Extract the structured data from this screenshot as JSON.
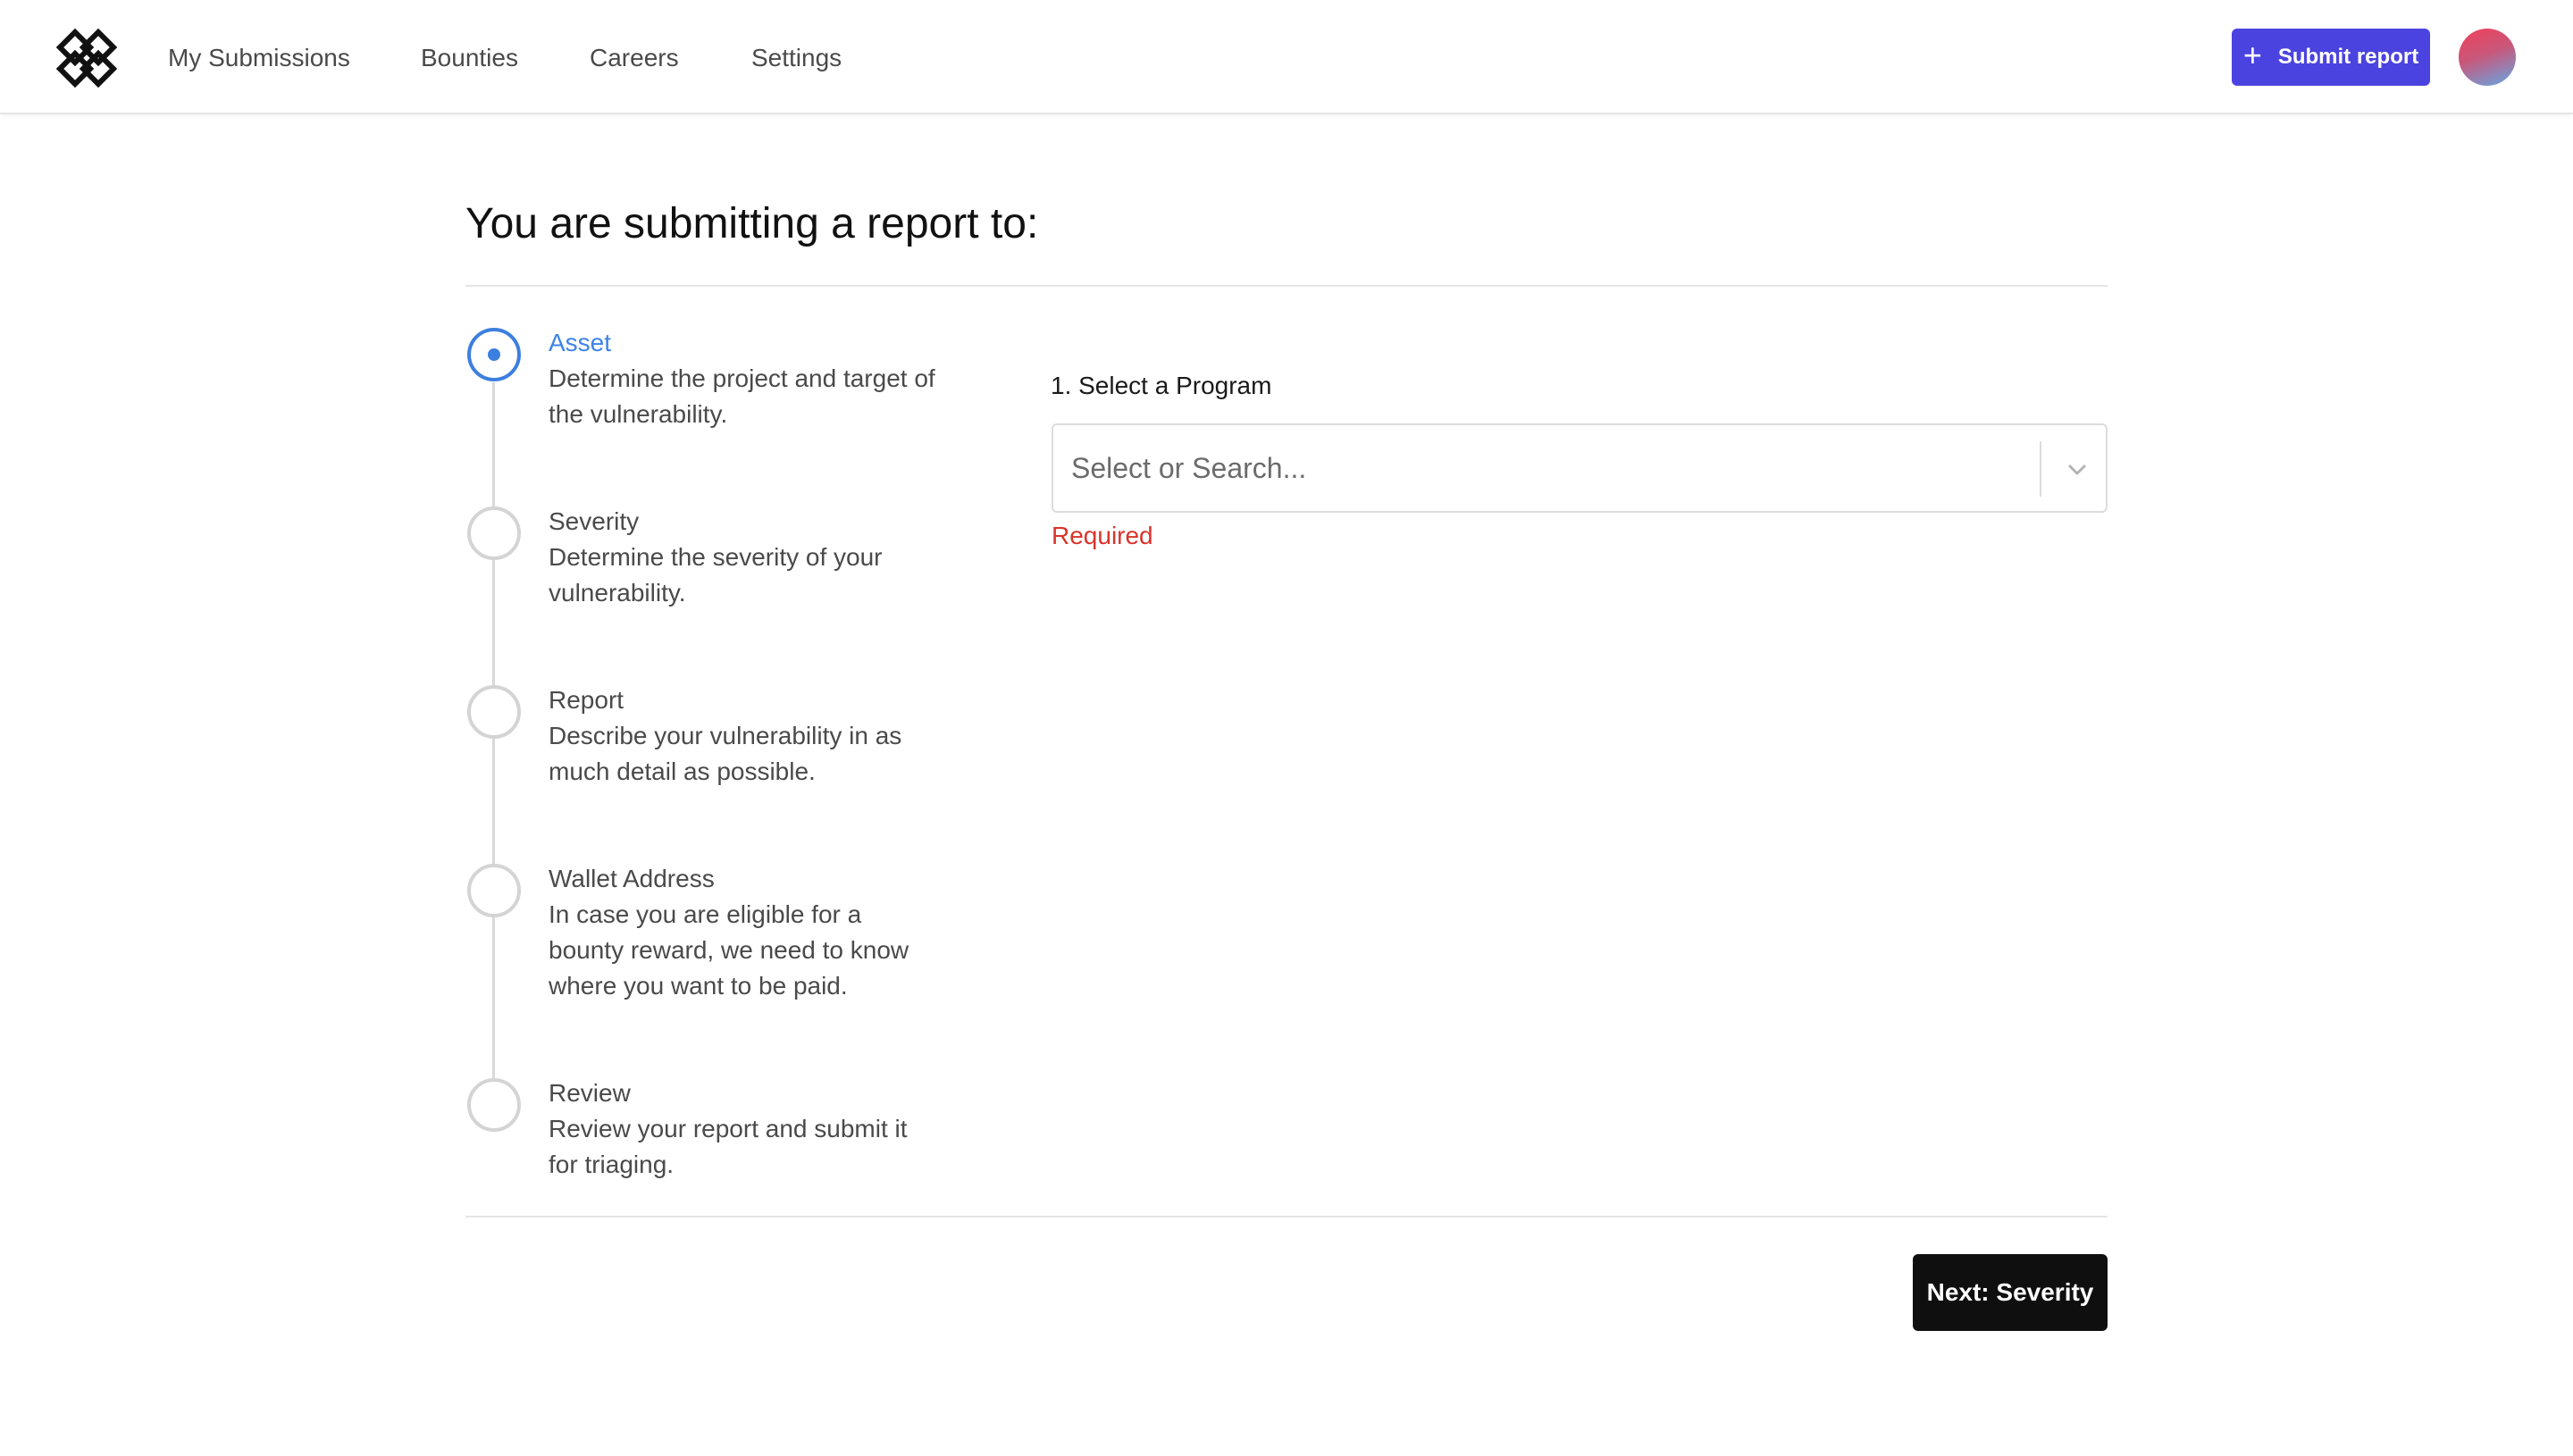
{
  "nav": {
    "links": [
      "My Submissions",
      "Bounties",
      "Careers",
      "Settings"
    ],
    "submit_report": "Submit report",
    "accent_color": "#4b43e0"
  },
  "main": {
    "title": "You are submitting a report to:",
    "steps": [
      {
        "title": "Asset",
        "description": "Determine the project and target of the vulnerability.",
        "status": "active"
      },
      {
        "title": "Severity",
        "description": "Determine the severity of your vulnerability.",
        "status": "pending"
      },
      {
        "title": "Report",
        "description": "Describe your vulnerability in as much detail as possible.",
        "status": "pending"
      },
      {
        "title": "Wallet Address",
        "description": "In case you are eligible for a bounty reward, we need to know where you want to be paid.",
        "status": "pending"
      },
      {
        "title": "Review",
        "description": "Review your report and submit it for triaging.",
        "status": "pending"
      }
    ],
    "form": {
      "label": "1. Select a Program",
      "placeholder": "Select or Search...",
      "value": "",
      "error": "Required",
      "error_color": "#d9342b"
    },
    "next_button": "Next: Severity"
  }
}
